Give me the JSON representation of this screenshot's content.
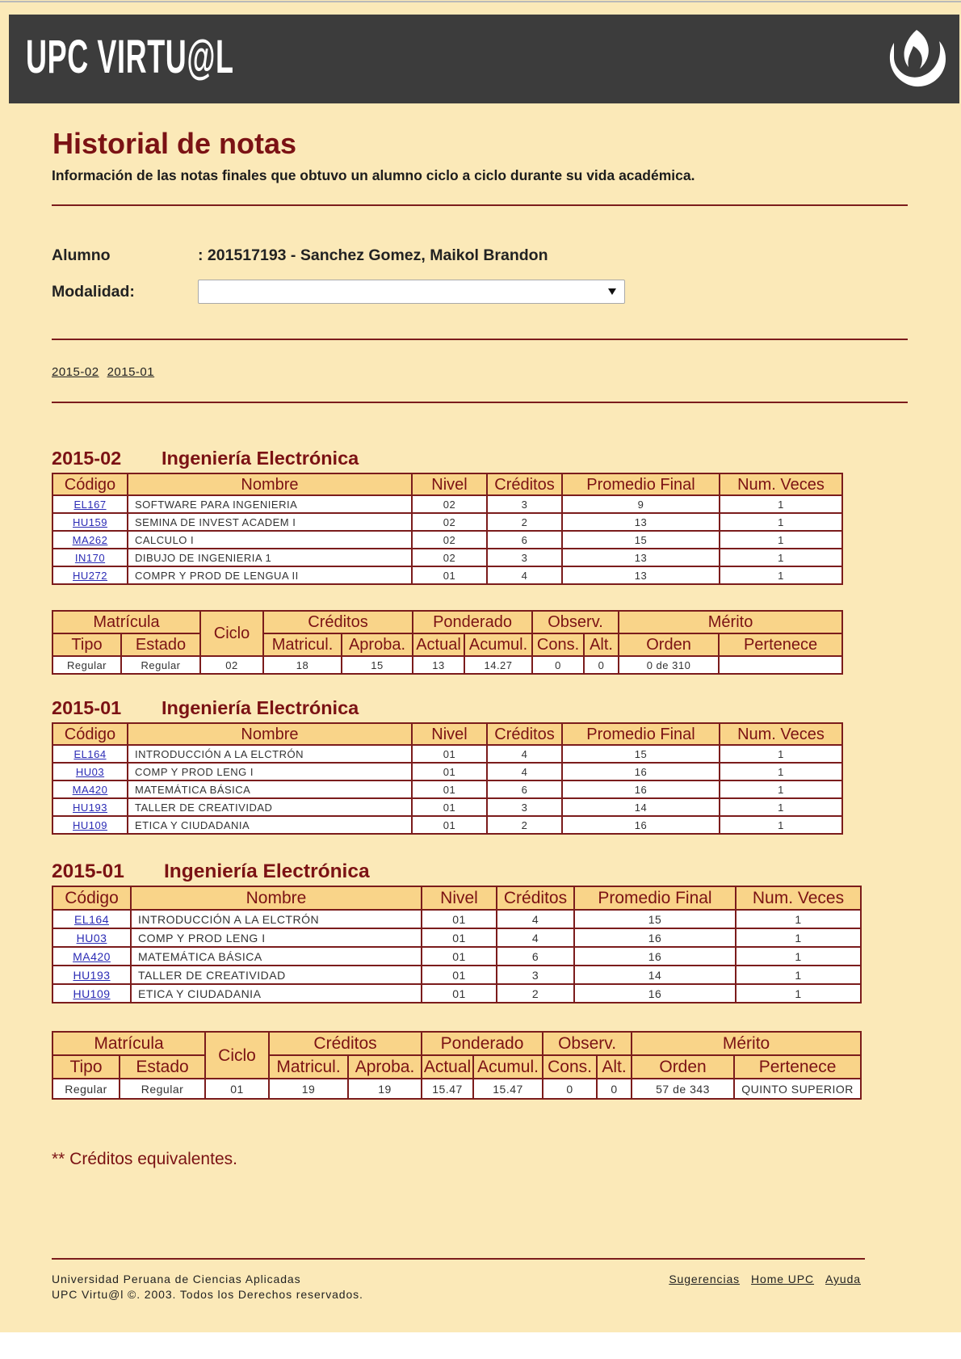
{
  "header": {
    "logo_text": "UPC VIRTU@L",
    "logo_icon": "upc-logo-icon"
  },
  "page": {
    "title": "Historial de notas",
    "subtitle": "Información de las notas finales que obtuvo un alumno ciclo a ciclo durante su vida académica."
  },
  "student": {
    "alumno_label": "Alumno",
    "alumno_value": ": 201517193 - Sanchez Gomez, Maikol Brandon",
    "modalidad_label": "Modalidad:",
    "dropdown_icon": "chevron-down-icon"
  },
  "period_links": [
    "2015-02",
    "2015-01"
  ],
  "course_columns": [
    "Código",
    "Nombre",
    "Nivel",
    "Créditos",
    "Promedio Final",
    "Num. Veces"
  ],
  "summary_columns": {
    "groups": [
      "Matrícula",
      "Ciclo",
      "Créditos",
      "Ponderado",
      "Observ.",
      "Mérito"
    ],
    "sub": [
      "Tipo",
      "Estado",
      "Matricul.",
      "Aproba.",
      "Actual",
      "Acumul.",
      "Cons.",
      "Alt.",
      "Orden",
      "Pertenece"
    ]
  },
  "sections": [
    {
      "period": "2015-02",
      "career": "Ingeniería Electrónica",
      "courses": [
        {
          "code": "EL167",
          "name": "SOFTWARE PARA INGENIERIA",
          "nivel": "02",
          "creditos": "3",
          "promedio": "9",
          "veces": "1"
        },
        {
          "code": "HU159",
          "name": "SEMINA DE INVEST ACADEM I",
          "nivel": "02",
          "creditos": "2",
          "promedio": "13",
          "veces": "1"
        },
        {
          "code": "MA262",
          "name": "CALCULO I",
          "nivel": "02",
          "creditos": "6",
          "promedio": "15",
          "veces": "1"
        },
        {
          "code": "IN170",
          "name": "DIBUJO DE INGENIERIA 1",
          "nivel": "02",
          "creditos": "3",
          "promedio": "13",
          "veces": "1"
        },
        {
          "code": "HU272",
          "name": "COMPR Y PROD DE LENGUA II",
          "nivel": "01",
          "creditos": "4",
          "promedio": "13",
          "veces": "1"
        }
      ],
      "summary": {
        "tipo": "Regular",
        "estado": "Regular",
        "ciclo": "02",
        "matricul": "18",
        "aproba": "15",
        "actual": "13",
        "acumul": "14.27",
        "cons": "0",
        "alt": "0",
        "orden": "0 de 310",
        "pertenece": ""
      }
    },
    {
      "period": "2015-01",
      "career": "Ingeniería Electrónica",
      "courses": [
        {
          "code": "EL164",
          "name": "INTRODUCCIÓN A LA ELCTRÓN",
          "nivel": "01",
          "creditos": "4",
          "promedio": "15",
          "veces": "1"
        },
        {
          "code": "HU03",
          "name": "COMP Y PROD LENG I",
          "nivel": "01",
          "creditos": "4",
          "promedio": "16",
          "veces": "1"
        },
        {
          "code": "MA420",
          "name": "MATEMÁTICA BÁSICA",
          "nivel": "01",
          "creditos": "6",
          "promedio": "16",
          "veces": "1"
        },
        {
          "code": "HU193",
          "name": "TALLER DE CREATIVIDAD",
          "nivel": "01",
          "creditos": "3",
          "promedio": "14",
          "veces": "1"
        },
        {
          "code": "HU109",
          "name": "ETICA Y CIUDADANIA",
          "nivel": "01",
          "creditos": "2",
          "promedio": "16",
          "veces": "1"
        }
      ],
      "summary": null
    },
    {
      "period": "2015-01",
      "career": "Ingeniería Electrónica",
      "courses": [
        {
          "code": "EL164",
          "name": "INTRODUCCIÓN A LA ELCTRÓN",
          "nivel": "01",
          "creditos": "4",
          "promedio": "15",
          "veces": "1"
        },
        {
          "code": "HU03",
          "name": "COMP Y PROD LENG I",
          "nivel": "01",
          "creditos": "4",
          "promedio": "16",
          "veces": "1"
        },
        {
          "code": "MA420",
          "name": "MATEMÁTICA BÁSICA",
          "nivel": "01",
          "creditos": "6",
          "promedio": "16",
          "veces": "1"
        },
        {
          "code": "HU193",
          "name": "TALLER DE CREATIVIDAD",
          "nivel": "01",
          "creditos": "3",
          "promedio": "14",
          "veces": "1"
        },
        {
          "code": "HU109",
          "name": "ETICA Y CIUDADANIA",
          "nivel": "01",
          "creditos": "2",
          "promedio": "16",
          "veces": "1"
        }
      ],
      "summary": {
        "tipo": "Regular",
        "estado": "Regular",
        "ciclo": "01",
        "matricul": "19",
        "aproba": "19",
        "actual": "15.47",
        "acumul": "15.47",
        "cons": "0",
        "alt": "0",
        "orden": "57 de 343",
        "pertenece": "QUINTO SUPERIOR"
      }
    }
  ],
  "note": "** Créditos equivalentes.",
  "footer": {
    "line1": "Universidad Peruana de Ciencias Aplicadas",
    "line2": "UPC Virtu@l ©. 2003. Todos los Derechos reservados.",
    "links": [
      "Sugerencias",
      "Home UPC",
      "Ayuda"
    ]
  },
  "colors": {
    "background": "#FBE9B8",
    "header_bar": "#3C3C3C",
    "accent": "#7B1214",
    "table_header": "#F9D489",
    "table_border": "#7B1C1C",
    "link": "#2B2BB5"
  }
}
